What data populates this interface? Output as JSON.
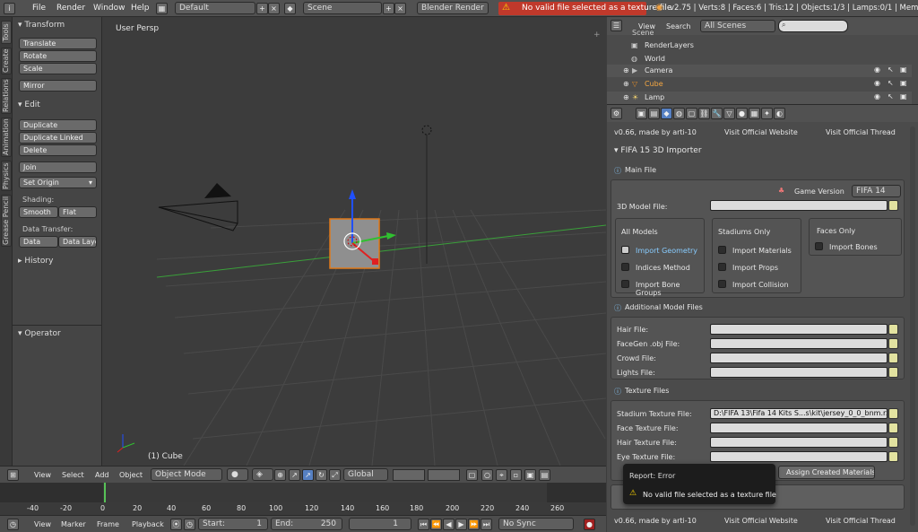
{
  "topbar": {
    "menus": [
      "File",
      "Render",
      "Window",
      "Help"
    ],
    "layout": "Default",
    "scene": "Scene",
    "engine": "Blender Render",
    "error_msg": "No valid file selected as a texture file",
    "stats": "v2.75 | Verts:8 | Faces:6 | Tris:12 | Objects:1/3 | Lamps:0/1 | Mem:9.85M |"
  },
  "left_tabs": [
    "Tools",
    "Create",
    "Relations",
    "Animation",
    "Physics",
    "Grease Pencil"
  ],
  "tools": {
    "transform_header": "Transform",
    "transform_buttons": [
      "Translate",
      "Rotate",
      "Scale"
    ],
    "mirror": "Mirror",
    "edit_header": "Edit",
    "edit_buttons": [
      "Duplicate",
      "Duplicate Linked",
      "Delete"
    ],
    "join": "Join",
    "set_origin": "Set Origin",
    "shading_label": "Shading:",
    "smooth": "Smooth",
    "flat": "Flat",
    "data_transfer_label": "Data Transfer:",
    "data": "Data",
    "data_layout": "Data Layo",
    "history": "History",
    "operator": "Operator"
  },
  "viewport": {
    "view_label": "User Persp",
    "object_label": "(1) Cube",
    "header": {
      "menus": [
        "View",
        "Select",
        "Add",
        "Object"
      ],
      "mode": "Object Mode",
      "orientation": "Global"
    }
  },
  "timeline": {
    "ticks": [
      "-40",
      "-20",
      "0",
      "20",
      "40",
      "60",
      "80",
      "100",
      "120",
      "140",
      "160",
      "180",
      "200",
      "220",
      "240",
      "260"
    ],
    "menus": [
      "View",
      "Marker",
      "Frame",
      "Playback"
    ],
    "start_label": "Start:",
    "start": "1",
    "end_label": "End:",
    "end": "250",
    "current": "1",
    "sync": "No Sync"
  },
  "outliner": {
    "menus": [
      "View",
      "Search"
    ],
    "filter": "All Scenes",
    "items": [
      "Scene",
      "RenderLayers",
      "World",
      "Camera",
      "Cube",
      "Lamp"
    ]
  },
  "props": {
    "version": "v0.66, made by arti-10",
    "visit1": "Visit Official Website",
    "visit2": "Visit Official Thread",
    "addon_title": "FIFA 15 3D Importer",
    "main_file": "Main File",
    "game_version_label": "Game Version",
    "game_version": "FIFA 14",
    "model_file_label": "3D Model File:",
    "all_models": "All Models",
    "import_geometry": "Import Geometry",
    "indices_method": "Indices Method",
    "import_bone_groups": "Import Bone Groups",
    "stadiums_only": "Stadiums Only",
    "import_materials": "Import Materials",
    "import_props": "Import Props",
    "import_collision": "Import Collision",
    "faces_only": "Faces Only",
    "import_bones": "Import Bones",
    "additional": "Additional Model Files",
    "hair_file": "Hair File:",
    "facegen_file": "FaceGen .obj File:",
    "crowd_file": "Crowd File:",
    "lights_file": "Lights File:",
    "texture_files": "Texture Files",
    "stadium_tex": "Stadium Texture File:",
    "stadium_tex_value": "D:\\FIFA 13\\Fifa 14 Kits S...s\\kit\\jersey_0_0_bnm.rx3",
    "face_tex": "Face Texture File:",
    "hair_tex": "Hair Texture File:",
    "eye_tex": "Eye Texture File:",
    "assign_materials": "Assign Created Materials",
    "report_title": "Report: Error",
    "report_msg": "No valid file selected as a texture file",
    "footer_version": "v0.66, made by arti-10",
    "footer_visit1": "Visit Official Website",
    "footer_visit2": "Visit Official Thread"
  }
}
